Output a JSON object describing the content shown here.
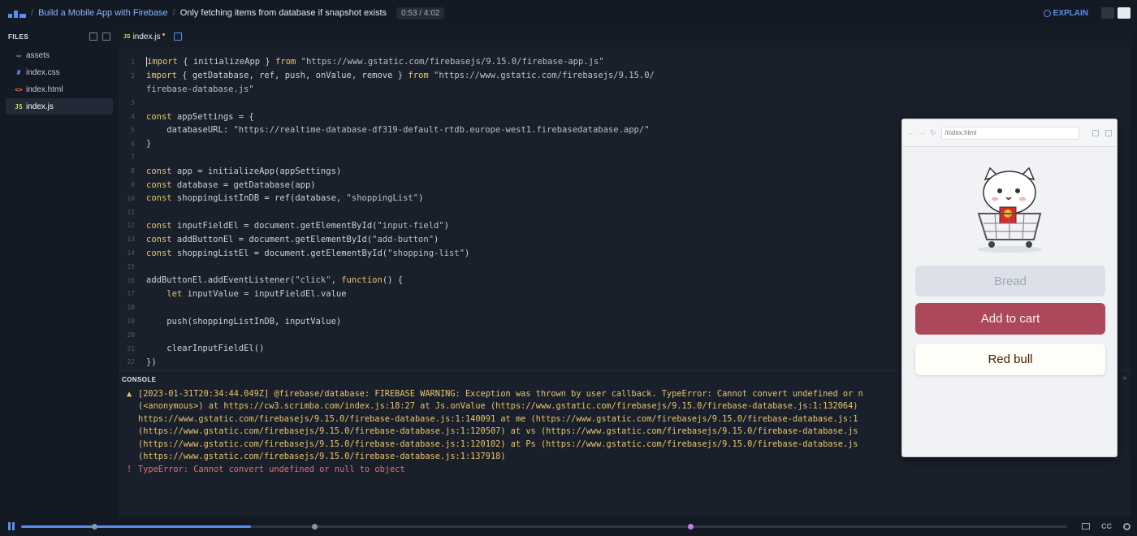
{
  "topbar": {
    "course": "Build a Mobile App with Firebase",
    "lesson": "Only fetching items from database if snapshot exists",
    "time": "0:53 / 4:02",
    "explain": "EXPLAIN"
  },
  "sidebar": {
    "title": "FILES",
    "files": [
      {
        "icon": "folder-icon",
        "glyph": "▭",
        "name": "assets"
      },
      {
        "icon": "css-file-icon",
        "glyph": "#",
        "name": "index.css"
      },
      {
        "icon": "html-file-icon",
        "glyph": "<>",
        "name": "index.html"
      },
      {
        "icon": "js-file-icon",
        "glyph": "JS",
        "name": "index.js"
      }
    ]
  },
  "editor": {
    "tab": {
      "badge": "JS",
      "name": "index.js"
    },
    "lines": [
      {
        "n": "1",
        "parts": [
          [
            "kw",
            "import"
          ],
          [
            "src",
            " { initializeApp } "
          ],
          [
            "kw",
            "from"
          ],
          [
            "str",
            " \"https://www.gstatic.com/firebasejs/9.15.0/firebase-app.js\""
          ]
        ]
      },
      {
        "n": "2",
        "parts": [
          [
            "kw",
            "import"
          ],
          [
            "src",
            " { getDatabase, ref, push, onValue, remove } "
          ],
          [
            "kw",
            "from"
          ],
          [
            "str",
            " \"https://www.gstatic.com/firebasejs/9.15.0/"
          ]
        ]
      },
      {
        "n": "",
        "parts": [
          [
            "str",
            "firebase-database.js\""
          ]
        ]
      },
      {
        "n": "3",
        "parts": []
      },
      {
        "n": "4",
        "parts": [
          [
            "kw",
            "const"
          ],
          [
            "src",
            " appSettings = {"
          ]
        ]
      },
      {
        "n": "5",
        "parts": [
          [
            "src",
            "    databaseURL: "
          ],
          [
            "str",
            "\"https://realtime-database-df319-default-rtdb.europe-west1.firebasedatabase.app/\""
          ]
        ]
      },
      {
        "n": "6",
        "parts": [
          [
            "src",
            "}"
          ]
        ]
      },
      {
        "n": "7",
        "parts": []
      },
      {
        "n": "8",
        "parts": [
          [
            "kw",
            "const"
          ],
          [
            "src",
            " app = initializeApp(appSettings)"
          ]
        ]
      },
      {
        "n": "9",
        "parts": [
          [
            "kw",
            "const"
          ],
          [
            "src",
            " database = getDatabase(app)"
          ]
        ]
      },
      {
        "n": "10",
        "parts": [
          [
            "kw",
            "const"
          ],
          [
            "src",
            " shoppingListInDB = ref(database, "
          ],
          [
            "str",
            "\"shoppingList\""
          ],
          [
            "src",
            ")"
          ]
        ]
      },
      {
        "n": "11",
        "parts": []
      },
      {
        "n": "12",
        "parts": [
          [
            "kw",
            "const"
          ],
          [
            "src",
            " inputFieldEl = document.getElementById("
          ],
          [
            "str",
            "\"input-field\""
          ],
          [
            "src",
            ")"
          ]
        ]
      },
      {
        "n": "13",
        "parts": [
          [
            "kw",
            "const"
          ],
          [
            "src",
            " addButtonEl = document.getElementById("
          ],
          [
            "str",
            "\"add-button\""
          ],
          [
            "src",
            ")"
          ]
        ]
      },
      {
        "n": "14",
        "parts": [
          [
            "kw",
            "const"
          ],
          [
            "src",
            " shoppingListEl = document.getElementById("
          ],
          [
            "str",
            "\"shopping-list\""
          ],
          [
            "src",
            ")"
          ]
        ]
      },
      {
        "n": "15",
        "parts": []
      },
      {
        "n": "16",
        "parts": [
          [
            "src",
            "addButtonEl.addEventListener("
          ],
          [
            "str",
            "\"click\""
          ],
          [
            "src",
            ", "
          ],
          [
            "kw",
            "function"
          ],
          [
            "src",
            "() {"
          ]
        ]
      },
      {
        "n": "17",
        "parts": [
          [
            "src",
            "    "
          ],
          [
            "kw",
            "let"
          ],
          [
            "src",
            " inputValue = inputFieldEl.value"
          ]
        ]
      },
      {
        "n": "18",
        "parts": []
      },
      {
        "n": "19",
        "parts": [
          [
            "src",
            "    push(shoppingListInDB, inputValue)"
          ]
        ]
      },
      {
        "n": "20",
        "parts": []
      },
      {
        "n": "21",
        "parts": [
          [
            "src",
            "    clearInputFieldEl()"
          ]
        ]
      },
      {
        "n": "22",
        "parts": [
          [
            "src",
            "})"
          ]
        ]
      }
    ]
  },
  "console": {
    "title": "CONSOLE",
    "close": "×",
    "lines": [
      {
        "type": "warn",
        "mark": "▲",
        "text": "[2023-01-31T20:34:44.049Z] @firebase/database: FIREBASE WARNING: Exception was thrown by user callback. TypeError: Cannot convert undefined or n"
      },
      {
        "type": "warn",
        "mark": "",
        "text": "(<anonymous>) at https://cw3.scrimba.com/index.js:18:27 at Js.onValue (https://www.gstatic.com/firebasejs/9.15.0/firebase-database.js:1:132064)"
      },
      {
        "type": "warn",
        "mark": "",
        "text": "https://www.gstatic.com/firebasejs/9.15.0/firebase-database.js:1:140091 at me (https://www.gstatic.com/firebasejs/9.15.0/firebase-database.js:1"
      },
      {
        "type": "warn",
        "mark": "",
        "text": "(https://www.gstatic.com/firebasejs/9.15.0/firebase-database.js:1:120507) at vs (https://www.gstatic.com/firebasejs/9.15.0/firebase-database.js"
      },
      {
        "type": "warn",
        "mark": "",
        "text": "(https://www.gstatic.com/firebasejs/9.15.0/firebase-database.js:1:120102) at Ps (https://www.gstatic.com/firebasejs/9.15.0/firebase-database.js"
      },
      {
        "type": "warn",
        "mark": "",
        "text": "(https://www.gstatic.com/firebasejs/9.15.0/firebase-database.js:1:137918)"
      },
      {
        "type": "err",
        "mark": "!",
        "text": "TypeError: Cannot convert undefined or null to object"
      }
    ]
  },
  "preview": {
    "url": "/index.html",
    "input_placeholder": "Bread",
    "add_button": "Add to cart",
    "items": [
      "Red bull"
    ]
  },
  "player": {
    "progress": 0.22,
    "markers": [
      0.07,
      0.28,
      0.64
    ],
    "cc": "CC"
  },
  "colors": {
    "accent": "#5b8def",
    "keyword": "#e7c46a",
    "button": "#ac485a"
  }
}
